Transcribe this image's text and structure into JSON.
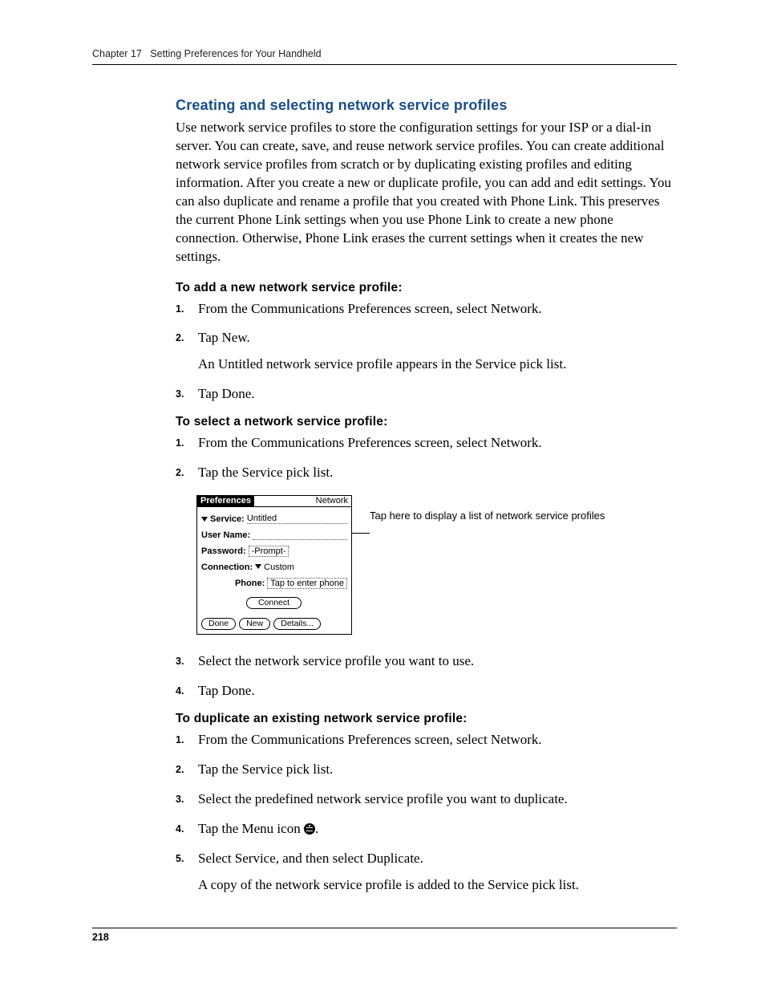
{
  "header": {
    "chapter": "Chapter 17",
    "title": "Setting Preferences for Your Handheld"
  },
  "section": {
    "heading": "Creating and selecting network service profiles",
    "intro": "Use network service profiles to store the configuration settings for your ISP or a dial-in server. You can create, save, and reuse network service profiles. You can create additional network service profiles from scratch or by duplicating existing profiles and editing information. After you create a new or duplicate profile, you can add and edit settings. You can also duplicate and rename a profile that you created with Phone Link. This preserves the current Phone Link settings when you use Phone Link to create a new phone connection. Otherwise, Phone Link erases the current settings when it creates the new settings."
  },
  "proc_add": {
    "heading": "To add a new network service profile:",
    "steps": [
      {
        "t": "From the Communications Preferences screen, select Network."
      },
      {
        "t": "Tap New.",
        "sub": "An Untitled network service profile appears in the Service pick list."
      },
      {
        "t": "Tap Done."
      }
    ]
  },
  "proc_select": {
    "heading": "To select a network service profile:",
    "steps_a": [
      {
        "t": "From the Communications Preferences screen, select Network."
      },
      {
        "t": "Tap the Service pick list."
      }
    ],
    "steps_b": [
      {
        "t": "Select the network service profile you want to use."
      },
      {
        "t": "Tap Done."
      }
    ]
  },
  "proc_dup": {
    "heading": "To duplicate an existing network service profile:",
    "steps": [
      {
        "t": "From the Communications Preferences screen, select Network."
      },
      {
        "t": "Tap the Service pick list."
      },
      {
        "t": "Select the predefined network service profile you want to duplicate."
      },
      {
        "t_pre": "Tap the Menu icon ",
        "t_post": "."
      },
      {
        "t": "Select Service, and then select Duplicate.",
        "sub": "A copy of the network service profile is added to the Service pick list."
      }
    ]
  },
  "screenshot": {
    "callout": "Tap here to display a list of network service profiles",
    "palm": {
      "titlebar_left": "Preferences",
      "titlebar_right": "Network",
      "service_label": "Service:",
      "service_value": "Untitled",
      "username_label": "User Name:",
      "password_label": "Password:",
      "password_value": "-Prompt-",
      "connection_label": "Connection:",
      "connection_value": "Custom",
      "phone_label": "Phone:",
      "phone_value": "Tap to enter phone",
      "connect_btn": "Connect",
      "done_btn": "Done",
      "new_btn": "New",
      "details_btn": "Details..."
    }
  },
  "page_number": "218"
}
